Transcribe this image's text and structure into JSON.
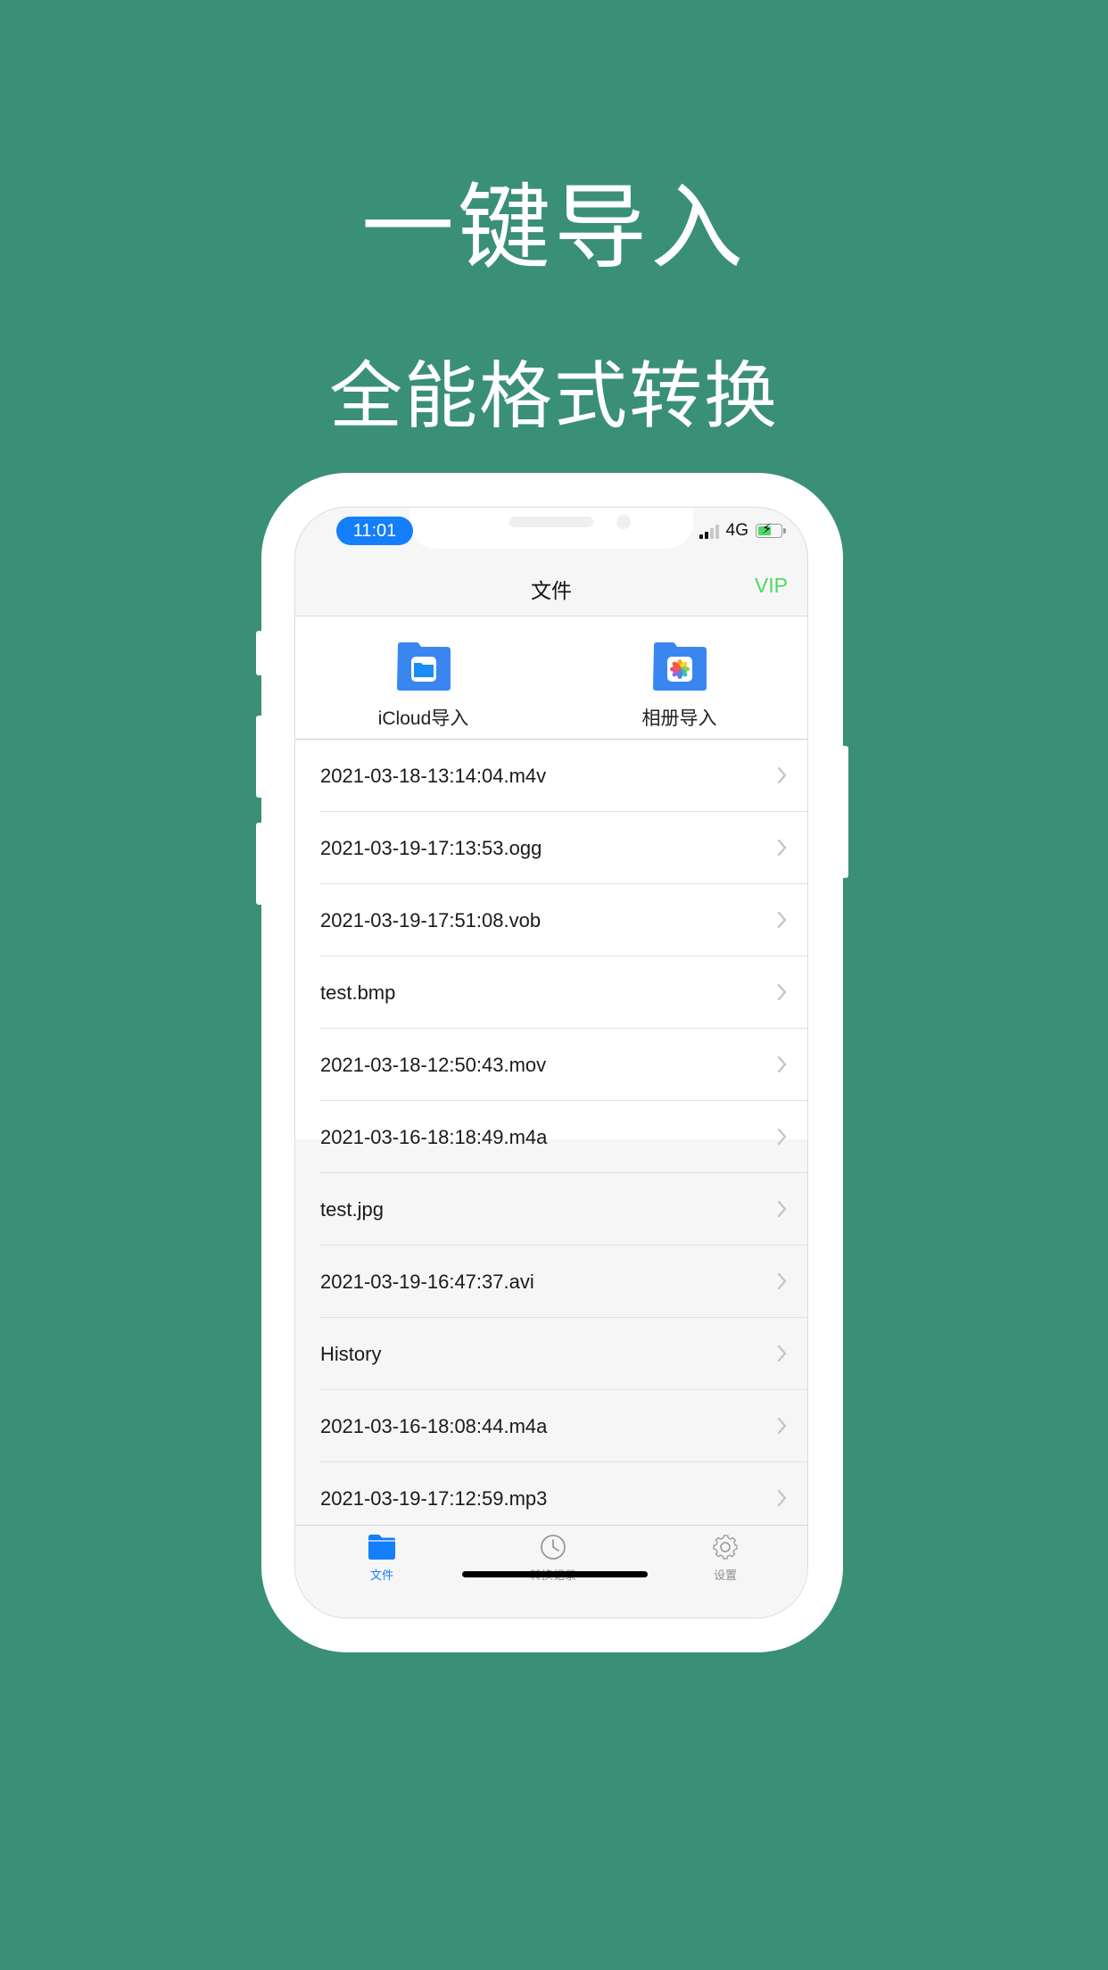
{
  "promo": {
    "headline": "一键导入",
    "subheadline": "全能格式转换"
  },
  "status_bar": {
    "time": "11:01",
    "network": "4G",
    "battery_charging": true
  },
  "navbar": {
    "title": "文件",
    "vip_label": "VIP"
  },
  "imports": [
    {
      "label": "iCloud导入",
      "icon": "files-folder-icon"
    },
    {
      "label": "相册导入",
      "icon": "photos-folder-icon"
    }
  ],
  "files": [
    {
      "name": "2021-03-18-13:14:04.m4v"
    },
    {
      "name": "2021-03-19-17:13:53.ogg"
    },
    {
      "name": "2021-03-19-17:51:08.vob"
    },
    {
      "name": "test.bmp"
    },
    {
      "name": "2021-03-18-12:50:43.mov"
    },
    {
      "name": "2021-03-16-18:18:49.m4a"
    },
    {
      "name": "test.jpg"
    },
    {
      "name": "2021-03-19-16:47:37.avi"
    },
    {
      "name": "History"
    },
    {
      "name": "2021-03-16-18:08:44.m4a"
    },
    {
      "name": "2021-03-19-17:12:59.mp3"
    }
  ],
  "tabbar": {
    "tabs": [
      {
        "label": "文件",
        "icon": "folder-icon",
        "active": true
      },
      {
        "label": "转换记录",
        "icon": "clock-icon",
        "active": false
      },
      {
        "label": "设置",
        "icon": "gear-icon",
        "active": false
      }
    ]
  },
  "colors": {
    "background": "#3a8f77",
    "accent": "#147efb",
    "vip": "#4cd964"
  }
}
